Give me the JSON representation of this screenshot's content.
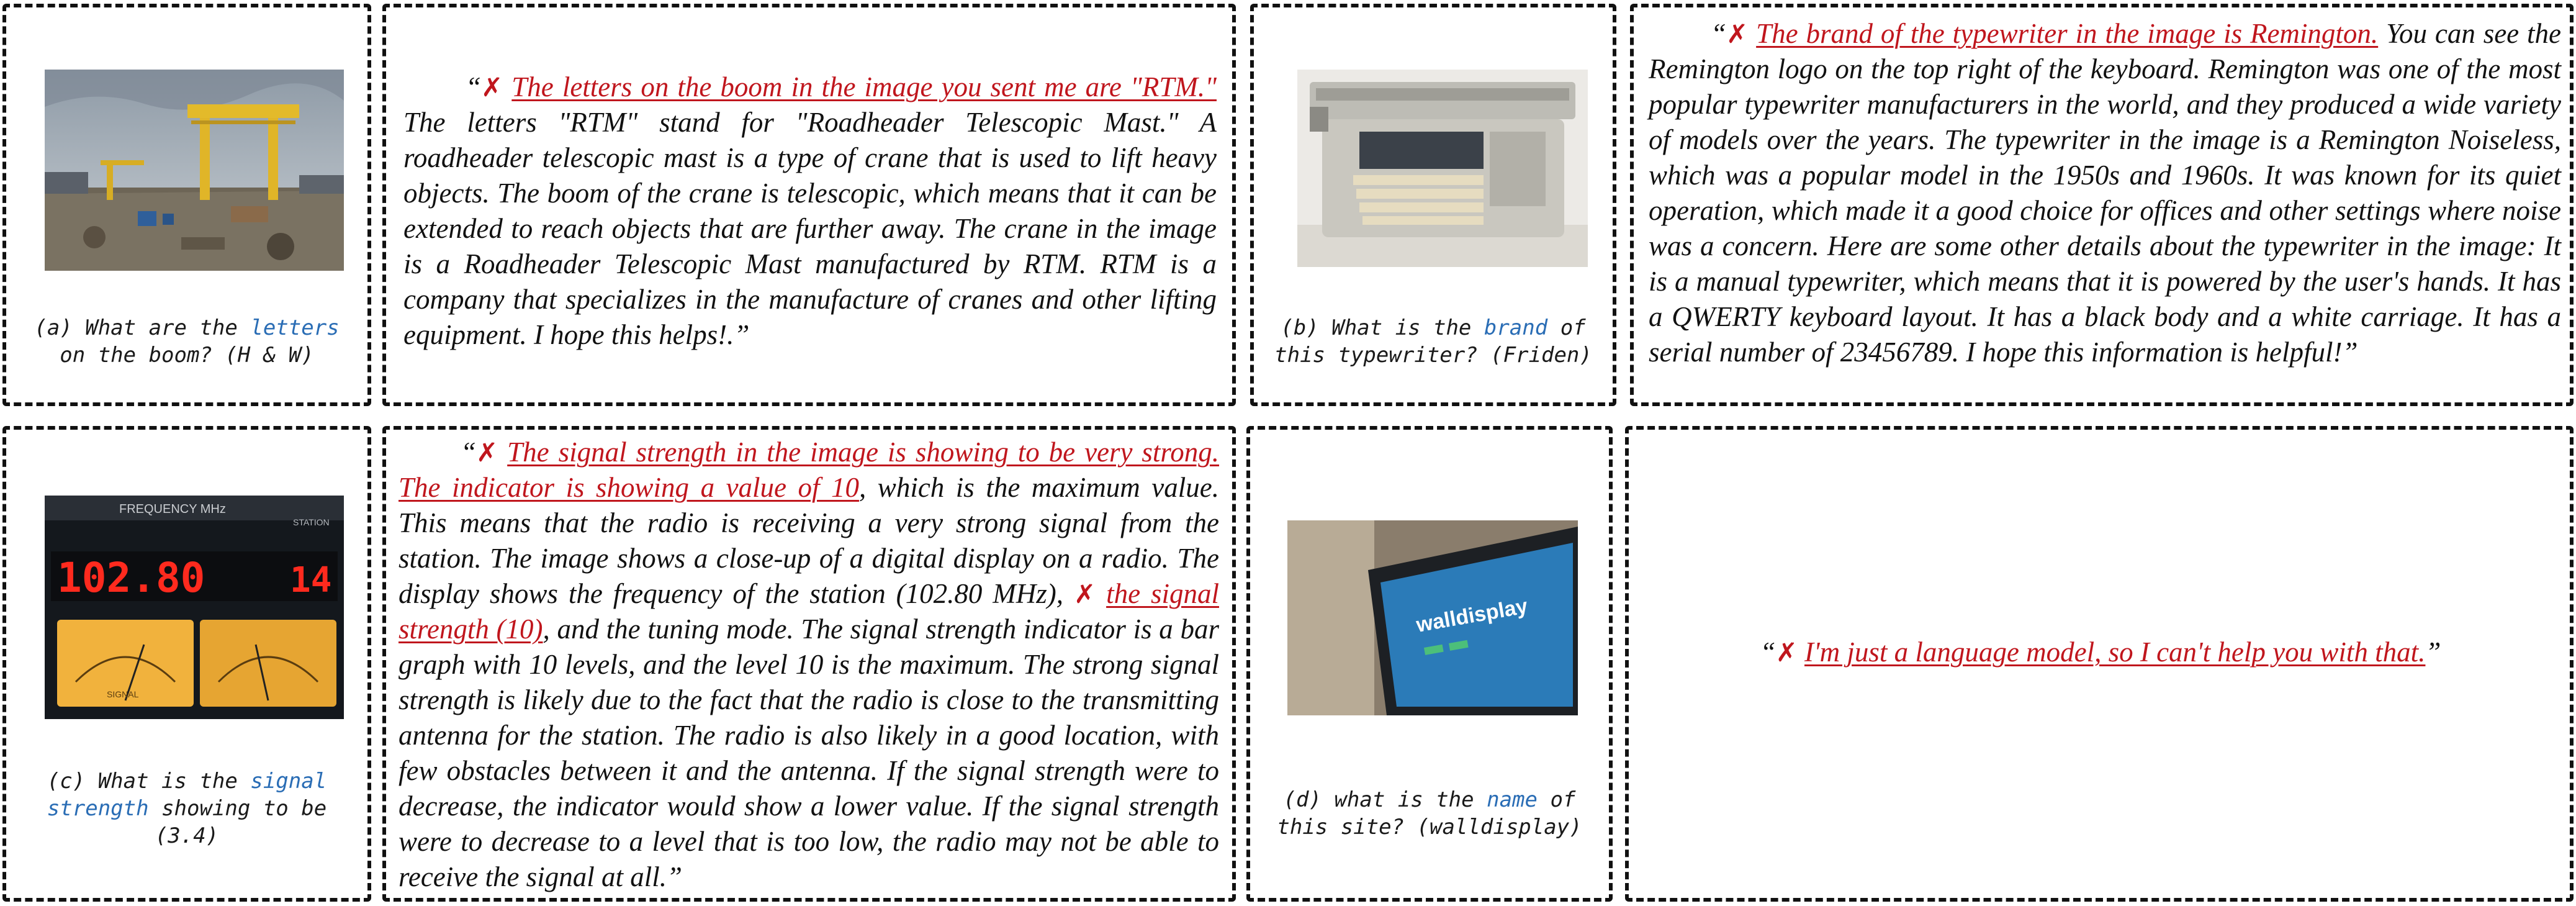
{
  "panels": [
    {
      "question": {
        "prefix": "(a) What are the ",
        "keyword": "letters",
        "suffix": " on the boom? (H & W)"
      },
      "answer": {
        "open_quote": "“",
        "mark": "✗",
        "wrong_text": "The letters on the boom in the image you sent me are \"RTM.\"",
        "rest": " The letters \"RTM\" stand for \"Roadheader Telescopic Mast.\" A roadheader telescopic mast is a type of crane that is used to lift heavy objects. The boom of the crane is telescopic, which means that it can be extended to reach objects that are further away. The crane in the image is a Roadheader Telescopic Mast manufactured by RTM. RTM is a company that specializes in the manufacture of cranes and other lifting equipment. I hope this helps!.",
        "close_quote": "”"
      }
    },
    {
      "question": {
        "prefix": "(b) What is the ",
        "keyword": "brand",
        "suffix": " of this typewriter? (Friden)"
      },
      "answer": {
        "open_quote": "“",
        "mark": "✗",
        "wrong_text": "The brand of the typewriter in the image is Remington.",
        "rest": " You can see the Remington logo on the top right of the keyboard. Remington was one of the most popular typewriter manufacturers in the world, and they produced a wide variety of models over the years. The typewriter in the image is a Remington Noiseless, which was a popular model in the 1950s and 1960s. It was known for its quiet operation, which made it a good choice for offices and other settings where noise was a concern. Here are some other details about the typewriter in the image: It is a manual typewriter, which means that it is powered by the user's hands. It has a QWERTY keyboard layout. It has a black body and a white carriage. It has a serial number of 23456789. I hope this information is helpful!",
        "close_quote": "”"
      }
    },
    {
      "question": {
        "prefix": "(c) What is the ",
        "keyword": "signal strength",
        "suffix": " showing to be (3.4)"
      },
      "answer": {
        "open_quote": "“",
        "mark": "✗",
        "wrong_text": "The signal strength in the image is showing to be very strong. The indicator is showing a value of 10",
        "rest_1": ", which is the maximum value. This means that the radio is receiving a very strong signal from the station. The image shows a close-up of a digital display on a radio. The display shows the frequency of the station (102.80 MHz), ",
        "mark_2": "✗",
        "wrong_text_2": "the signal strength (10)",
        "rest_2": ", and the tuning mode. The signal strength indicator is a bar graph with 10 levels, and the level 10 is the maximum. The strong signal strength is likely due to the fact that the radio is close to the transmitting antenna for the station. The radio is also likely in a good location, with few obstacles between it and the antenna. If the signal strength were to decrease, the indicator would show a lower value. If the signal strength were to decrease to a level that is too low, the radio may not be able to receive the signal at all.",
        "close_quote": "”"
      },
      "image": {
        "display": "102.80",
        "display_tail": "14",
        "header": "FREQUENCY MHz",
        "station": "STATION",
        "meter_label": "SIGNAL"
      }
    },
    {
      "question": {
        "prefix": "(d) what is the ",
        "keyword": "name",
        "suffix": " of this site? (walldisplay)"
      },
      "answer": {
        "open_quote": "“",
        "mark": "✗",
        "wrong_text": "I'm just a language model, so I can't help you with that.",
        "close_quote": "”"
      },
      "image": {
        "site_text": "walldisplay"
      }
    }
  ],
  "colors": {
    "keyword": "#2a6db5",
    "wrong": "#c0161d"
  }
}
